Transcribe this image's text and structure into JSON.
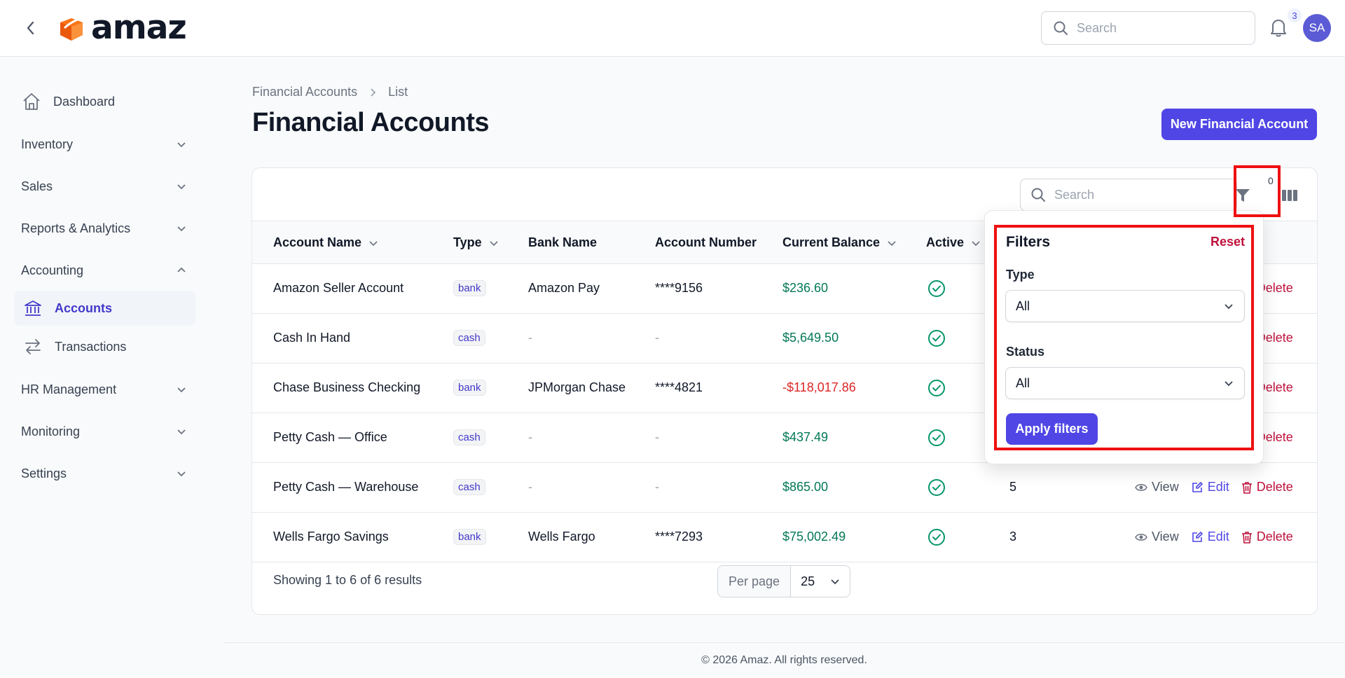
{
  "app": {
    "logo_text": "amaz",
    "search_placeholder": "Search",
    "notification_count": "3",
    "avatar_initials": "SA"
  },
  "sidebar": {
    "items": [
      {
        "label": "Dashboard",
        "icon": "home-icon"
      },
      {
        "label": "Inventory",
        "icon": "chevron-down-icon"
      },
      {
        "label": "Sales",
        "icon": "chevron-down-icon"
      },
      {
        "label": "Reports & Analytics",
        "icon": "chevron-down-icon"
      },
      {
        "label": "Accounting",
        "icon": "chevron-up-icon"
      },
      {
        "label": "Accounts",
        "icon": "bank-icon",
        "active": true
      },
      {
        "label": "Transactions",
        "icon": "arrows-exchange-icon"
      },
      {
        "label": "HR Management",
        "icon": "chevron-down-icon"
      },
      {
        "label": "Monitoring",
        "icon": "chevron-down-icon"
      },
      {
        "label": "Settings",
        "icon": "chevron-down-icon"
      }
    ]
  },
  "header": {
    "breadcrumb": [
      "Financial Accounts",
      "List"
    ],
    "title": "Financial Accounts",
    "new_button": "New Financial Account"
  },
  "table": {
    "search_placeholder": "Search",
    "active_filter_count": "0",
    "columns": [
      "Account Name",
      "Type",
      "Bank Name",
      "Account Number",
      "Current Balance",
      "Active"
    ],
    "rows": [
      {
        "name": "Amazon Seller Account",
        "type": "bank",
        "bank": "Amazon Pay",
        "number": "****9156",
        "balance": "$236.60",
        "transactions": ""
      },
      {
        "name": "Cash In Hand",
        "type": "cash",
        "bank": "-",
        "number": "-",
        "balance": "$5,649.50",
        "transactions": ""
      },
      {
        "name": "Chase Business Checking",
        "type": "bank",
        "bank": "JPMorgan Chase",
        "number": "****4821",
        "balance": "-$118,017.86",
        "transactions": ""
      },
      {
        "name": "Petty Cash — Office",
        "type": "cash",
        "bank": "-",
        "number": "-",
        "balance": "$437.49",
        "transactions": ""
      },
      {
        "name": "Petty Cash — Warehouse",
        "type": "cash",
        "bank": "-",
        "number": "-",
        "balance": "$865.00",
        "transactions": "5"
      },
      {
        "name": "Wells Fargo Savings",
        "type": "bank",
        "bank": "Wells Fargo",
        "number": "****7293",
        "balance": "$75,002.49",
        "transactions": "3"
      }
    ],
    "actions": {
      "view": "View",
      "edit": "Edit",
      "delete": "Delete"
    },
    "showing": "Showing 1 to 6 of 6 results",
    "per_page_label": "Per page",
    "per_page_value": "25"
  },
  "filters": {
    "title": "Filters",
    "reset": "Reset",
    "type_label": "Type",
    "type_value": "All",
    "status_label": "Status",
    "status_value": "All",
    "apply": "Apply filters"
  },
  "footer": {
    "copyright": "© 2026 Amaz. All rights reserved."
  },
  "colors": {
    "accent": "#4f46e5",
    "positive": "#047857",
    "negative": "#dc2626",
    "danger": "#be123c",
    "highlight": "#ef1010"
  }
}
